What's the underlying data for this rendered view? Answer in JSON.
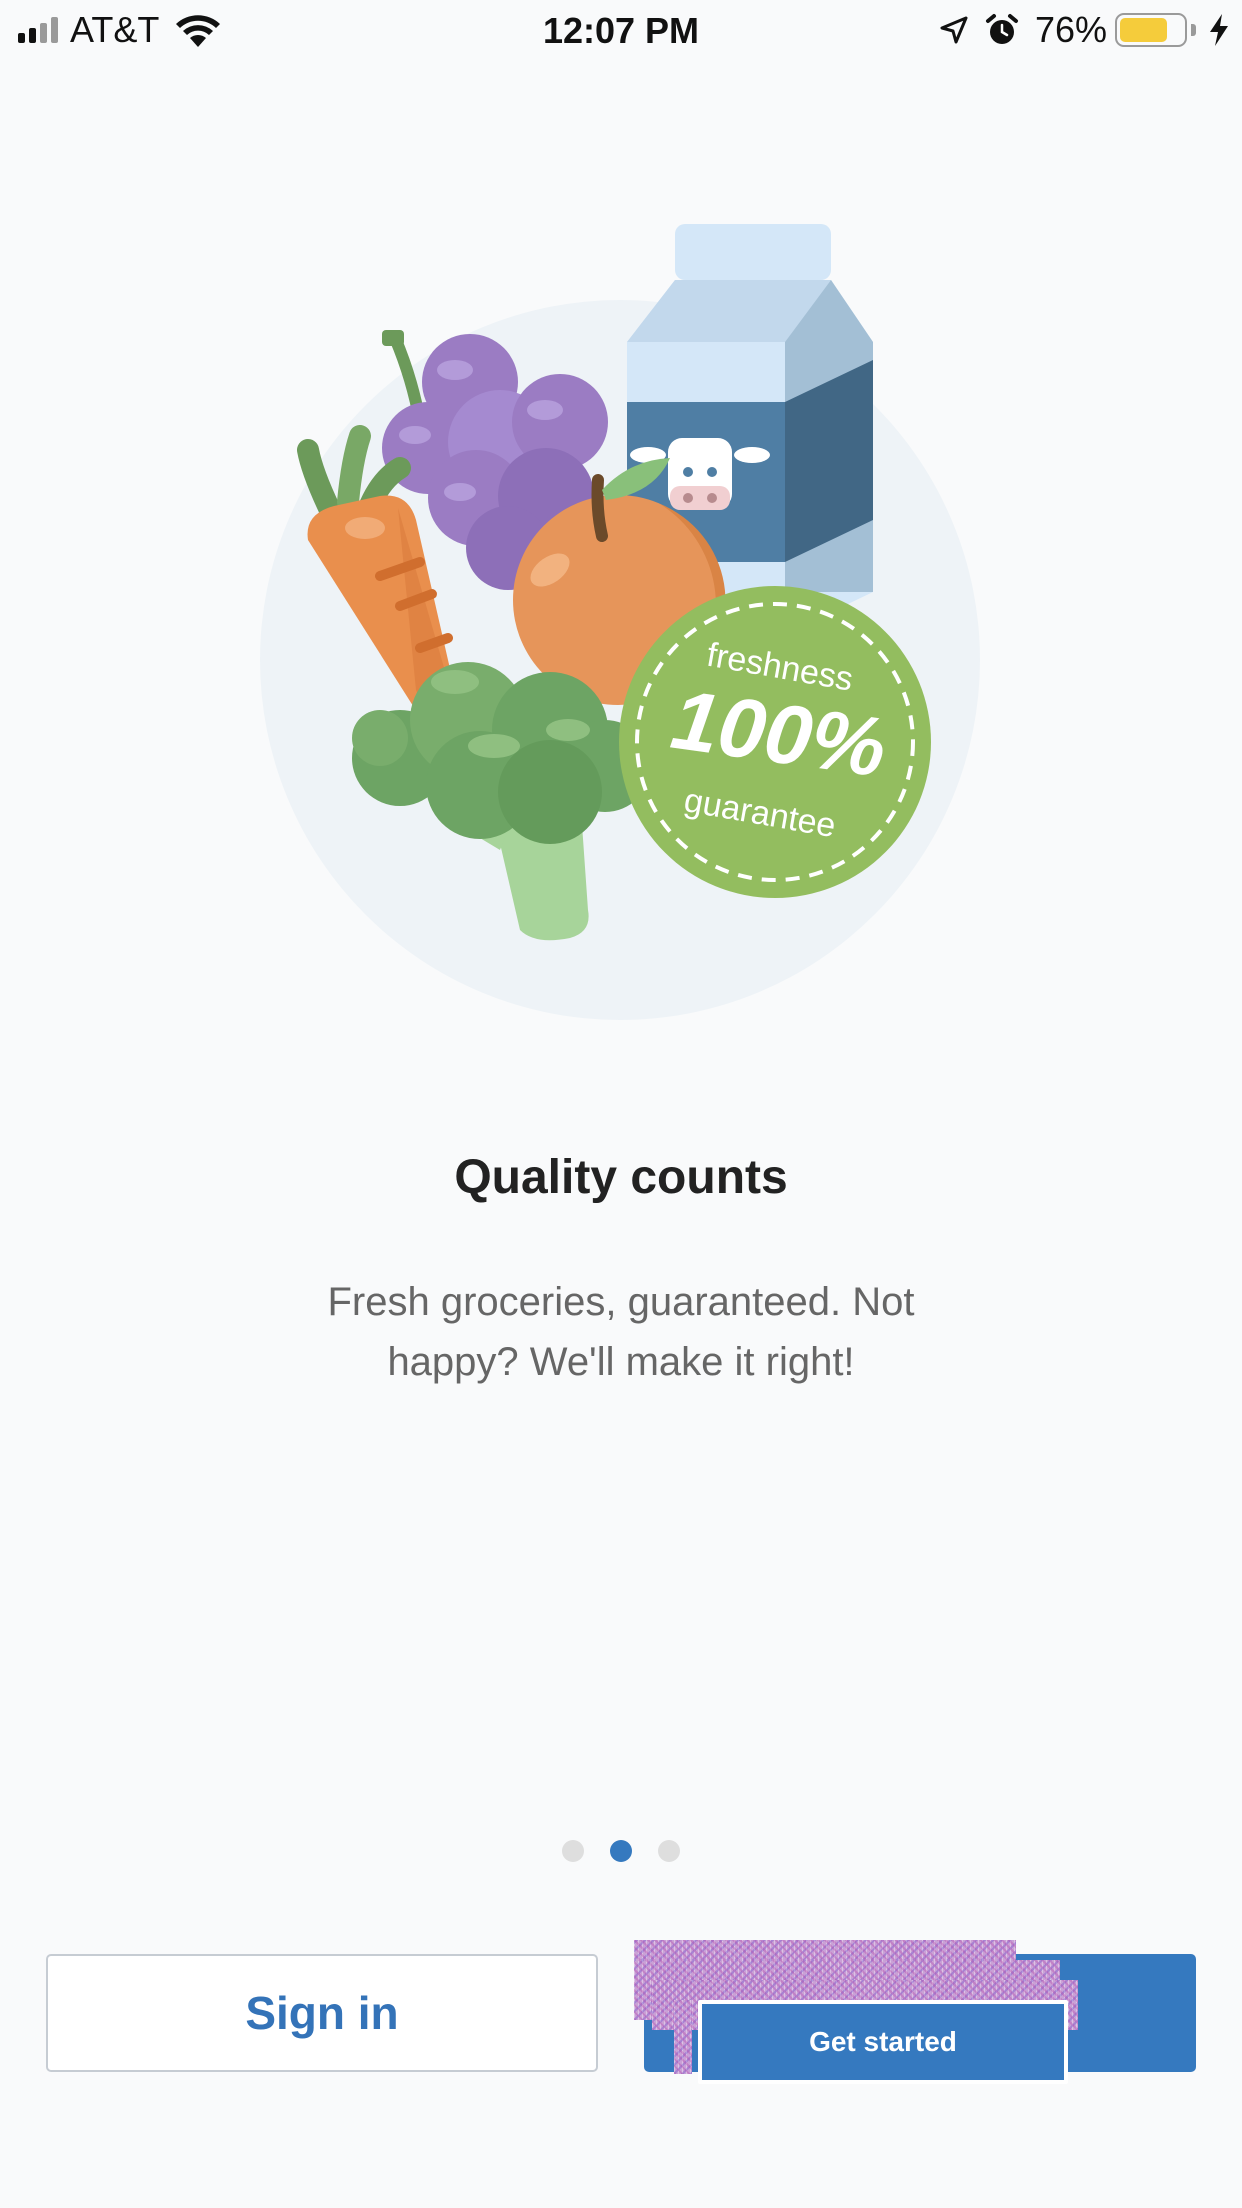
{
  "status_bar": {
    "carrier": "AT&T",
    "time": "12:07 PM",
    "battery_percent": "76%",
    "battery_level": 0.76,
    "icons": [
      "signal-icon",
      "wifi-icon",
      "location-arrow-icon",
      "alarm-icon",
      "battery-icon",
      "charging-bolt-icon"
    ]
  },
  "illustration": {
    "badge_top": "freshness",
    "badge_main": "100%",
    "badge_bottom": "guarantee"
  },
  "onboarding": {
    "title": "Quality counts",
    "subtitle": "Fresh groceries, guaranteed. Not happy? We'll make it right!",
    "page_indicator": {
      "total": 3,
      "current": 2
    }
  },
  "buttons": {
    "sign_in": "Sign in",
    "get_started": "Get started"
  },
  "colors": {
    "accent": "#3579bf",
    "badge_green": "#93bd5f",
    "background": "#f9fafb"
  }
}
